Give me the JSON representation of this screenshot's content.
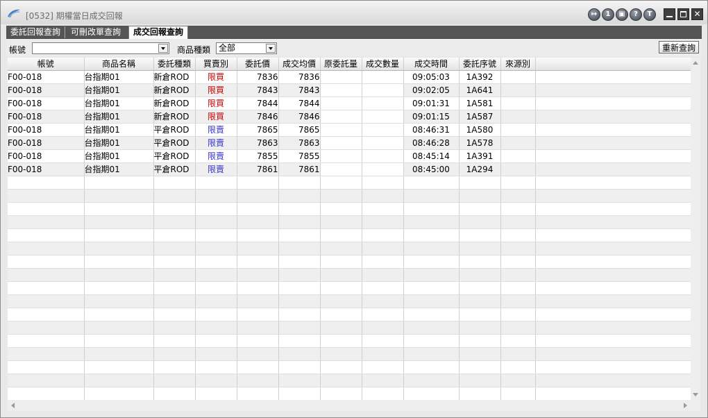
{
  "window": {
    "title": "[0532] 期權當日成交回報",
    "title_icons": [
      "exit-icon",
      "1",
      "export-icon",
      "?",
      "T"
    ]
  },
  "tabs": [
    {
      "label": "委託回報查詢"
    },
    {
      "label": "可刪改單查詢"
    },
    {
      "label": "成交回報查詢",
      "active": true
    }
  ],
  "filters": {
    "account_label": "帳號",
    "account_value": "",
    "product_type_label": "商品種類",
    "product_type_value": "全部",
    "reset_button": "重新查詢"
  },
  "table": {
    "columns": [
      "帳號",
      "商品名稱",
      "委託種類",
      "買賣別",
      "委託價",
      "成交均價",
      "原委託量",
      "成交數量",
      "成交時間",
      "委託序號",
      "來源別"
    ],
    "rows": [
      {
        "account": "F00-018",
        "product": "台指期01",
        "order_type": "新倉ROD",
        "side": "限買",
        "side_kind": "buy",
        "price": "7836",
        "avg_price": "7836",
        "orig_qty": "",
        "filled_qty": "",
        "time": "09:05:03",
        "seq": "1A392",
        "source": ""
      },
      {
        "account": "F00-018",
        "product": "台指期01",
        "order_type": "新倉ROD",
        "side": "限買",
        "side_kind": "buy",
        "price": "7843",
        "avg_price": "7843",
        "orig_qty": "",
        "filled_qty": "",
        "time": "09:02:05",
        "seq": "1A641",
        "source": ""
      },
      {
        "account": "F00-018",
        "product": "台指期01",
        "order_type": "新倉ROD",
        "side": "限買",
        "side_kind": "buy",
        "price": "7844",
        "avg_price": "7844",
        "orig_qty": "",
        "filled_qty": "",
        "time": "09:01:31",
        "seq": "1A581",
        "source": ""
      },
      {
        "account": "F00-018",
        "product": "台指期01",
        "order_type": "新倉ROD",
        "side": "限買",
        "side_kind": "buy",
        "price": "7846",
        "avg_price": "7846",
        "orig_qty": "",
        "filled_qty": "",
        "time": "09:01:15",
        "seq": "1A587",
        "source": ""
      },
      {
        "account": "F00-018",
        "product": "台指期01",
        "order_type": "平倉ROD",
        "side": "限賣",
        "side_kind": "sell",
        "price": "7865",
        "avg_price": "7865",
        "orig_qty": "",
        "filled_qty": "",
        "time": "08:46:31",
        "seq": "1A580",
        "source": ""
      },
      {
        "account": "F00-018",
        "product": "台指期01",
        "order_type": "平倉ROD",
        "side": "限賣",
        "side_kind": "sell",
        "price": "7863",
        "avg_price": "7863",
        "orig_qty": "",
        "filled_qty": "",
        "time": "08:46:28",
        "seq": "1A578",
        "source": ""
      },
      {
        "account": "F00-018",
        "product": "台指期01",
        "order_type": "平倉ROD",
        "side": "限賣",
        "side_kind": "sell",
        "price": "7855",
        "avg_price": "7855",
        "orig_qty": "",
        "filled_qty": "",
        "time": "08:45:14",
        "seq": "1A391",
        "source": ""
      },
      {
        "account": "F00-018",
        "product": "台指期01",
        "order_type": "平倉ROD",
        "side": "限賣",
        "side_kind": "sell",
        "price": "7861",
        "avg_price": "7861",
        "orig_qty": "",
        "filled_qty": "",
        "time": "08:45:00",
        "seq": "1A294",
        "source": ""
      }
    ]
  },
  "colors": {
    "buy": "#cc0000",
    "sell": "#3333cc",
    "tab_bar": "#555555"
  }
}
